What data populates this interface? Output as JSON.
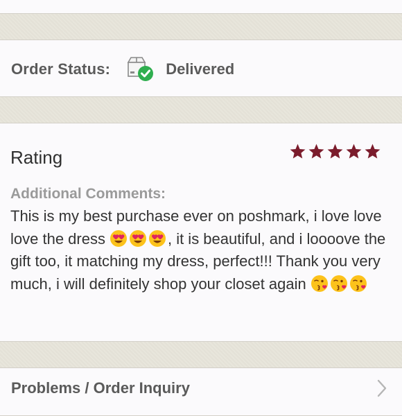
{
  "order_status": {
    "label": "Order Status:",
    "value": "Delivered",
    "icon": "package-delivered-icon",
    "check_color": "#2fae4f"
  },
  "review": {
    "title": "Rating",
    "stars": 5,
    "star_color": "#7b1c2c",
    "comments_label": "Additional Comments:",
    "comment_part1": "This is my best purchase ever on poshmark, i love love love the dress",
    "comment_part2": ", it is beautiful, and i loooove the gift too, it matching my dress, perfect!!! Thank you very much, i will definitely shop your closet again",
    "emojis_1": [
      "heart-eyes-emoji",
      "heart-eyes-emoji",
      "heart-eyes-emoji"
    ],
    "emojis_2": [
      "kissing-heart-emoji",
      "kissing-heart-emoji",
      "kissing-heart-emoji"
    ]
  },
  "problems": {
    "label": "Problems / Order Inquiry",
    "icon": "chevron-right-icon"
  }
}
